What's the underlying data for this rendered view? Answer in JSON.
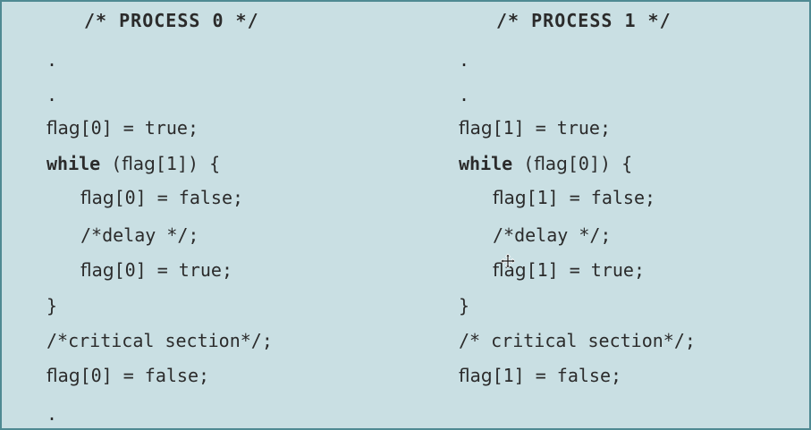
{
  "process0": {
    "header": "/* PROCESS 0 */",
    "dot1": ".",
    "dot2": ".",
    "line_flag_true_a": "flag",
    "line_flag_true_b": "[0]",
    "line_flag_true_c": " = true;",
    "while_kw": "while",
    "while_rest_a": " (",
    "while_rest_b": "flag",
    "while_rest_c": "[1]) {",
    "inner1_a": "flag",
    "inner1_b": "[0]",
    "inner1_c": " = false;",
    "delay": "/*delay */;",
    "inner3_a": "flag",
    "inner3_b": "[0]",
    "inner3_c": " = true;",
    "close_brace": "}",
    "critical": "/*critical section*/;",
    "reset_a": "flag",
    "reset_b": "[0]",
    "reset_c": " = false;",
    "dot3": "."
  },
  "process1": {
    "header": "/* PROCESS 1 */",
    "dot1": ".",
    "dot2": ".",
    "line_flag_true_a": "flag",
    "line_flag_true_b": "[1]",
    "line_flag_true_c": " = true;",
    "while_kw": "while",
    "while_rest_a": " (",
    "while_rest_b": "flag",
    "while_rest_c": "[0]) {",
    "inner1_a": "flag",
    "inner1_b": "[1]",
    "inner1_c": " = false;",
    "delay": "/*delay */;",
    "inner3_a": "flag",
    "inner3_b": "[1]",
    "inner3_c": " = true;",
    "close_brace": "}",
    "critical": "/* critical section*/;",
    "reset_a": "flag",
    "reset_b": "[1]",
    "reset_c": " = false;"
  },
  "cursor_icon": "move-cursor-icon"
}
